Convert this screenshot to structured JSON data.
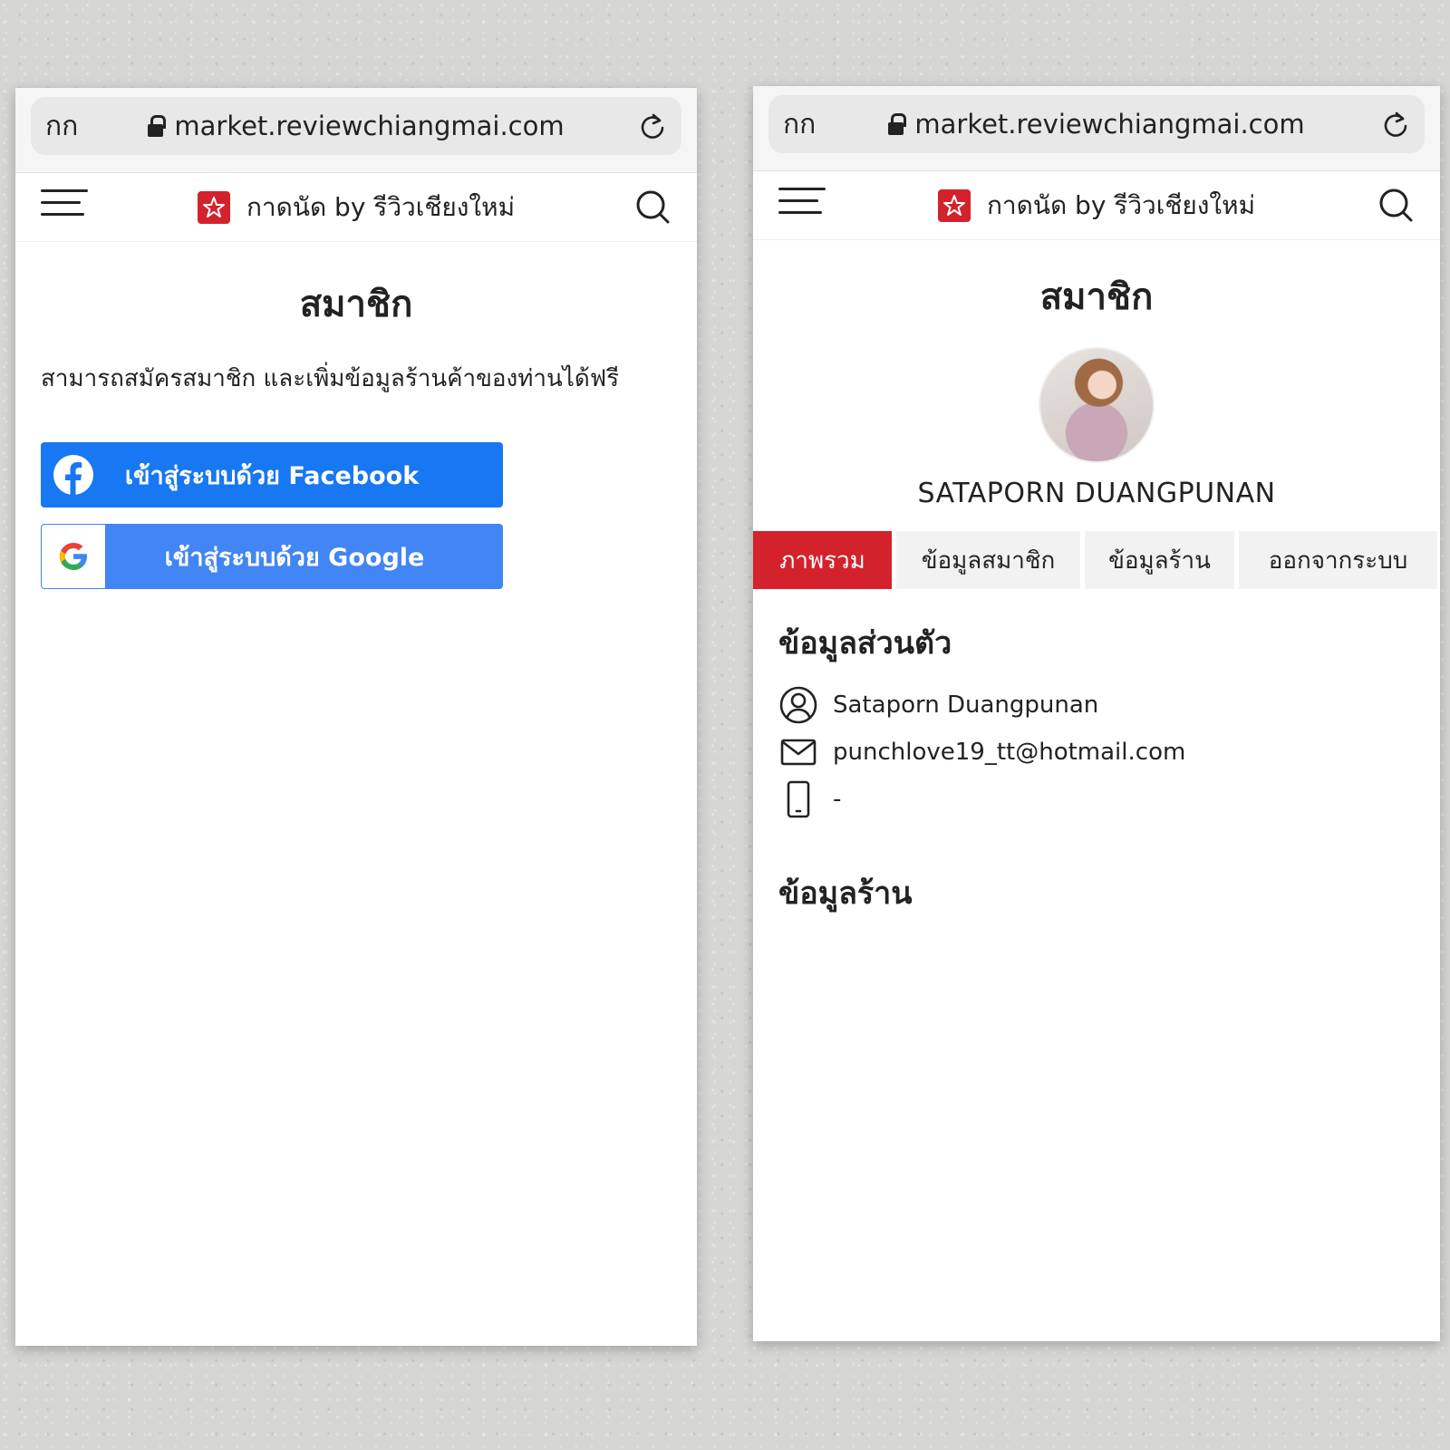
{
  "browser": {
    "text_size_label": "กก",
    "url": "market.reviewchiangmai.com"
  },
  "site": {
    "brand_name": "กาดนัด by รีวิวเชียงใหม่",
    "brand_color": "#d3222c"
  },
  "login_screen": {
    "title": "สมาชิก",
    "description": "สามารถสมัครสมาชิก และเพิ่มข้อมูลร้านค้าของท่านได้ฟรี",
    "facebook_button": "เข้าสู่ระบบด้วย Facebook",
    "google_button": "เข้าสู่ระบบด้วย Google",
    "facebook_color": "#1877f2",
    "google_color": "#4285f4"
  },
  "profile_screen": {
    "title": "สมาชิก",
    "member_name": "SATAPORN DUANGPUNAN",
    "tabs": [
      {
        "label": "ภาพรวม",
        "active": true
      },
      {
        "label": "ข้อมูลสมาชิก",
        "active": false
      },
      {
        "label": "ข้อมูลร้าน",
        "active": false
      },
      {
        "label": "ออกจากระบบ",
        "active": false
      }
    ],
    "personal_section_title": "ข้อมูลส่วนตัว",
    "personal_info": {
      "name": "Sataporn Duangpunan",
      "email": "punchlove19_tt@hotmail.com",
      "phone": "-"
    },
    "shop_section_title": "ข้อมูลร้าน"
  },
  "icons": {
    "menu": "hamburger-menu-icon",
    "search": "search-icon",
    "reload": "reload-icon",
    "lock": "lock-icon",
    "user": "user-circle-icon",
    "mail": "mail-icon",
    "phone": "phone-icon"
  }
}
